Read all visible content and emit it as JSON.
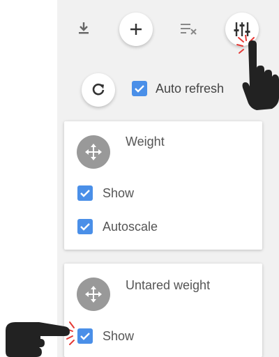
{
  "toolbar": {
    "download_icon": "download-icon",
    "add_icon": "plus-icon",
    "clear_icon": "clear-format-icon",
    "settings_icon": "sliders-icon"
  },
  "refresh": {
    "icon": "refresh-icon",
    "auto_refresh_label": "Auto refresh",
    "auto_refresh_checked": true
  },
  "cards": [
    {
      "title": "Weight",
      "options": [
        {
          "label": "Show",
          "checked": true
        },
        {
          "label": "Autoscale",
          "checked": true
        }
      ]
    },
    {
      "title": "Untared weight",
      "options": [
        {
          "label": "Show",
          "checked": true
        }
      ]
    }
  ],
  "colors": {
    "accent": "#4a8fe8",
    "panel_bg": "#f1f1f1",
    "handle": "#999999",
    "pointer": "#222222",
    "click_burst": "#e53935"
  }
}
